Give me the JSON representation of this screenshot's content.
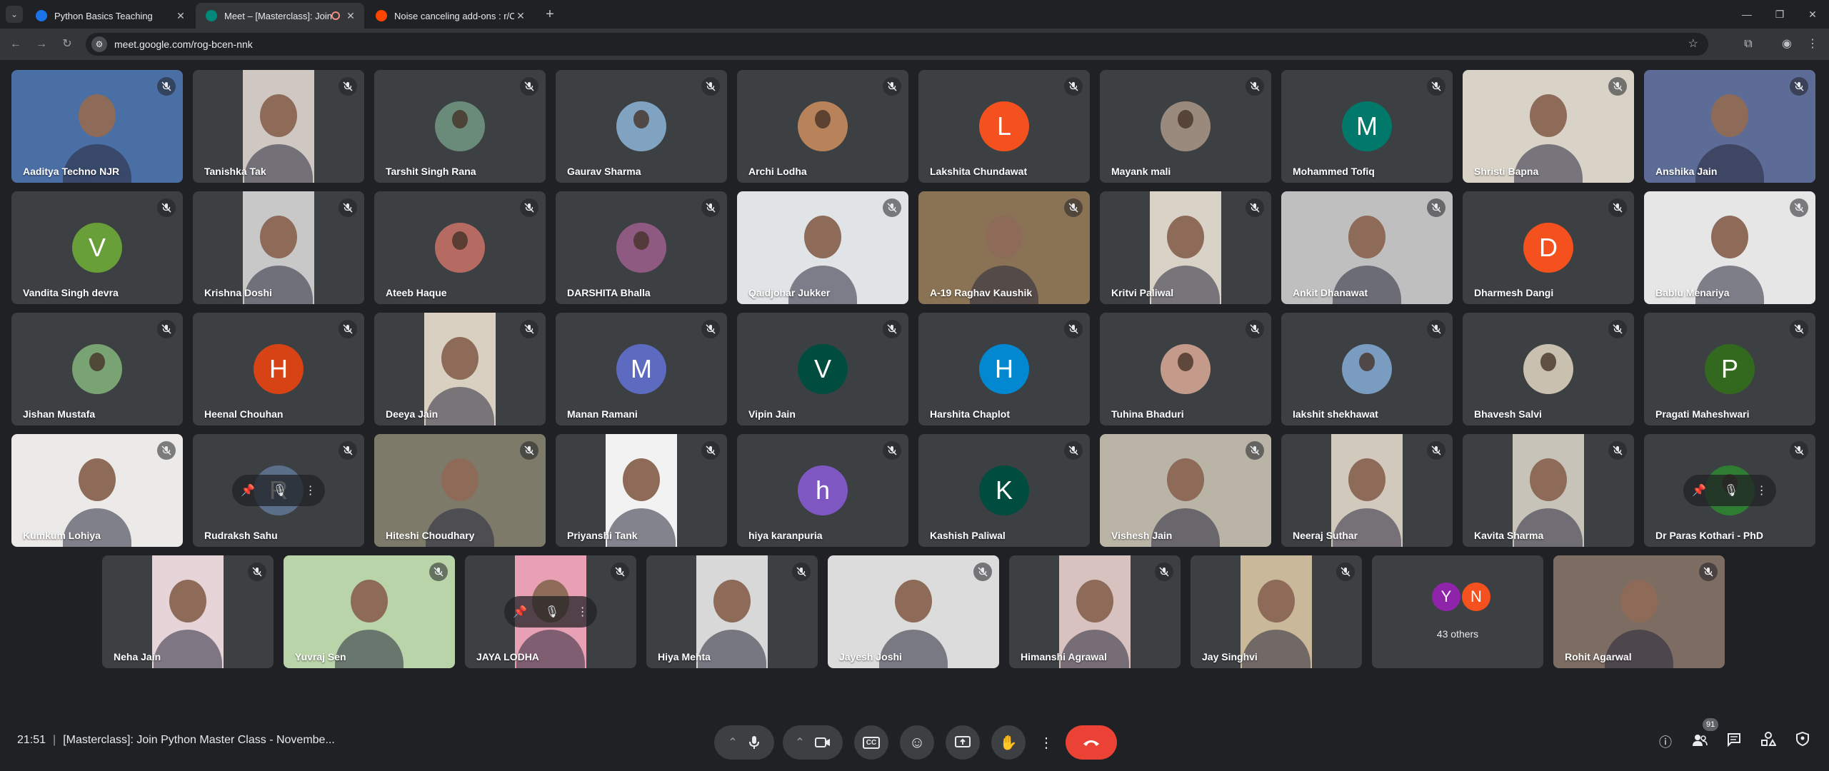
{
  "browser": {
    "tabs": [
      {
        "title": "Python Basics Teaching",
        "active": false,
        "favicon_color": "#1a73e8"
      },
      {
        "title": "Meet – [Masterclass]: Join P",
        "active": true,
        "favicon_color": "#00897b"
      },
      {
        "title": "Noise canceling add-ons : r/Ca",
        "active": false,
        "favicon_color": "#ff4500"
      }
    ],
    "url": "meet.google.com/rog-bcen-nnk"
  },
  "meet": {
    "participants": [
      {
        "name": "Aaditya Techno NJR",
        "kind": "video",
        "bg": "#4a6fa5"
      },
      {
        "name": "Tanishka Tak",
        "kind": "video",
        "bg": "#cfc7c1"
      },
      {
        "name": "Tarshit Singh Rana",
        "kind": "photo",
        "bg": "#6a8a7a"
      },
      {
        "name": "Gaurav Sharma",
        "kind": "photo",
        "bg": "#7fa3c0"
      },
      {
        "name": "Archi Lodha",
        "kind": "photo",
        "bg": "#b8835a"
      },
      {
        "name": "Lakshita Chundawat",
        "kind": "letter",
        "letter": "L",
        "bg": "#f4511e"
      },
      {
        "name": "Mayank mali",
        "kind": "photo",
        "bg": "#9a8a7d"
      },
      {
        "name": "Mohammed Tofiq",
        "kind": "letter",
        "letter": "M",
        "bg": "#00796b"
      },
      {
        "name": "Shristi Bapna",
        "kind": "video",
        "bg": "#d8d2c7"
      },
      {
        "name": "Anshika Jain",
        "kind": "video",
        "bg": "#5c6c96"
      },
      {
        "name": "Vandita Singh devra",
        "kind": "letter",
        "letter": "V",
        "bg": "#689f38"
      },
      {
        "name": "Krishna Doshi",
        "kind": "video",
        "bg": "#c8c8c8"
      },
      {
        "name": "Ateeb Haque",
        "kind": "photo",
        "bg": "#b56b62"
      },
      {
        "name": "DARSHITA Bhalla",
        "kind": "photo",
        "bg": "#8e5a82"
      },
      {
        "name": "Qaidjohar Jukker",
        "kind": "video",
        "bg": "#e0e4e6"
      },
      {
        "name": "A-19 Raghav Kaushik",
        "kind": "video",
        "bg": "#8a7355"
      },
      {
        "name": "Kritvi Paliwal",
        "kind": "video",
        "bg": "#d9d2c6"
      },
      {
        "name": "Ankit Dhanawat",
        "kind": "video",
        "bg": "#bfbfbf"
      },
      {
        "name": "Dharmesh Dangi",
        "kind": "letter",
        "letter": "D",
        "bg": "#f4511e"
      },
      {
        "name": "Bablu Menariya",
        "kind": "video",
        "bg": "#e6e6e6"
      },
      {
        "name": "Jishan Mustafa",
        "kind": "photo",
        "bg": "#7aa374"
      },
      {
        "name": "Heenal Chouhan",
        "kind": "letter",
        "letter": "H",
        "bg": "#d84315"
      },
      {
        "name": "Deeya Jain",
        "kind": "video",
        "bg": "#d9d0c2"
      },
      {
        "name": "Manan Ramani",
        "kind": "letter",
        "letter": "M",
        "bg": "#5c6bc0"
      },
      {
        "name": "Vipin Jain",
        "kind": "letter",
        "letter": "V",
        "bg": "#004d40"
      },
      {
        "name": "Harshita Chaplot",
        "kind": "letter",
        "letter": "H",
        "bg": "#0288d1"
      },
      {
        "name": "Tuhina Bhaduri",
        "kind": "photo",
        "bg": "#c49a8a"
      },
      {
        "name": "Iakshit shekhawat",
        "kind": "photo",
        "bg": "#7a9cc0"
      },
      {
        "name": "Bhavesh Salvi",
        "kind": "photo",
        "bg": "#c9c0b0"
      },
      {
        "name": "Pragati Maheshwari",
        "kind": "letter",
        "letter": "P",
        "bg": "#33691e"
      },
      {
        "name": "Kumkum Lohiya",
        "kind": "video",
        "bg": "#eceae8"
      },
      {
        "name": "Rudraksh Sahu",
        "kind": "letter-pinpop",
        "letter": "R",
        "bg": "#5b6f8a"
      },
      {
        "name": "Hiteshi Choudhary",
        "kind": "video",
        "bg": "#7d7a6a"
      },
      {
        "name": "Priyanshi Tank",
        "kind": "video",
        "bg": "#f2f2f2"
      },
      {
        "name": "hiya karanpuria",
        "kind": "letter",
        "letter": "h",
        "bg": "#7e57c2"
      },
      {
        "name": "Kashish Paliwal",
        "kind": "letter",
        "letter": "K",
        "bg": "#004d40"
      },
      {
        "name": "Vishesh Jain",
        "kind": "video",
        "bg": "#b9b4a6"
      },
      {
        "name": "Neeraj Suthar",
        "kind": "video",
        "bg": "#d2c9bd"
      },
      {
        "name": "Kavita Sharma",
        "kind": "video",
        "bg": "#c8c3b8"
      },
      {
        "name": "Dr Paras Kothari - PhD",
        "kind": "photo-pinpop",
        "bg": "#2e7d32"
      }
    ],
    "last_row": [
      {
        "name": "Neha Jain",
        "kind": "video",
        "bg": "#e7d4d8"
      },
      {
        "name": "Yuvraj Sen",
        "kind": "video",
        "bg": "#b9d4a8"
      },
      {
        "name": "JAYA LODHA",
        "kind": "video-pinpop",
        "bg": "#e8a0b4"
      },
      {
        "name": "Hiya Mehta",
        "kind": "video",
        "bg": "#d8d8d8"
      },
      {
        "name": "Jayesh Joshi",
        "kind": "video",
        "bg": "#dcdcdc"
      },
      {
        "name": "Himanshi Agrawal",
        "kind": "video",
        "bg": "#d7c2bf"
      },
      {
        "name": "Jay Singhvi",
        "kind": "video",
        "bg": "#c9b89a"
      },
      {
        "name": "43 others",
        "kind": "others"
      },
      {
        "name": "Rohit Agarwal",
        "kind": "video",
        "bg": "#7c6c62"
      }
    ],
    "others_avatars": [
      {
        "letter": "Y",
        "color": "#8e24aa"
      },
      {
        "letter": "N",
        "color": "#f4511e"
      }
    ]
  },
  "bottom_bar": {
    "time": "21:51",
    "meeting_title": "[Masterclass]: Join Python Master Class - Novembe...",
    "participant_count": "91"
  },
  "colors": {
    "hangup": "#ea4335",
    "top_icon": "#f9ab00",
    "tile_bg": "#3c4043"
  }
}
